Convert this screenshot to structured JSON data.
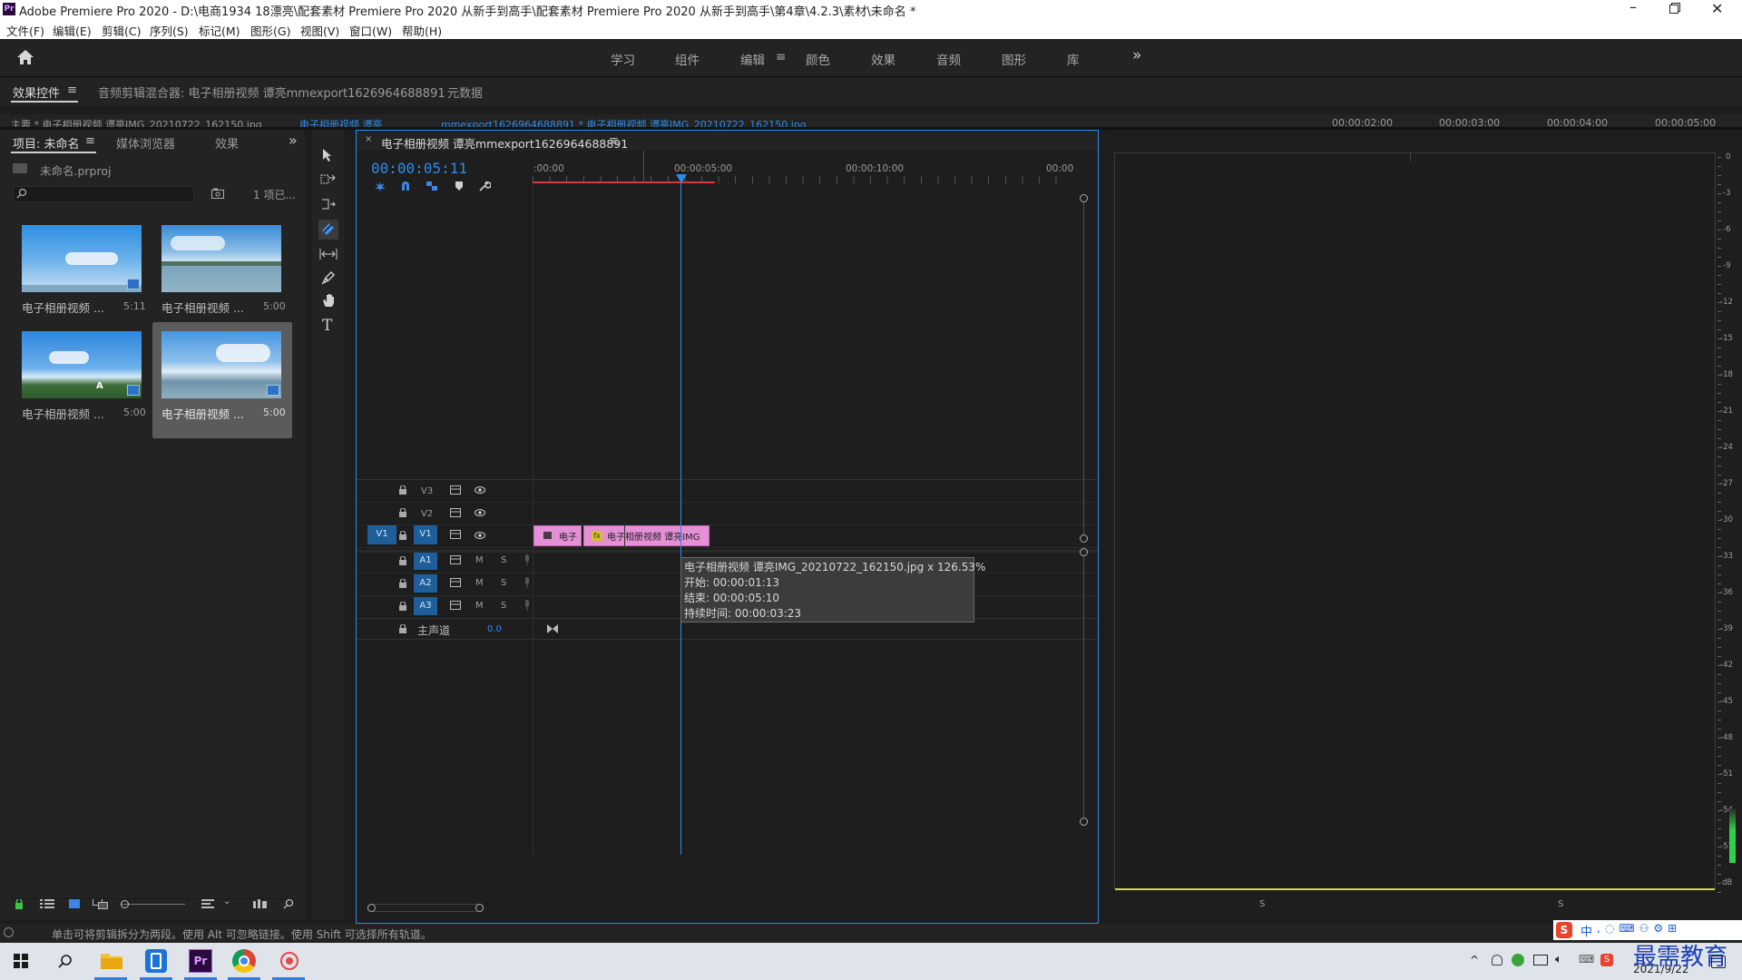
{
  "titlebar": {
    "title": "Adobe Premiere Pro 2020 - D:\\电商1934 18漂亮\\配套素材 Premiere Pro 2020 从新手到高手\\配套素材 Premiere Pro 2020 从新手到高手\\第4章\\4.2.3\\素材\\未命名 *",
    "app_icon": "Pr"
  },
  "menu": [
    "文件(F)",
    "编辑(E)",
    "剪辑(C)",
    "序列(S)",
    "标记(M)",
    "图形(G)",
    "视图(V)",
    "窗口(W)",
    "帮助(H)"
  ],
  "workspaces": {
    "tabs": [
      "学习",
      "组件",
      "编辑",
      "颜色",
      "效果",
      "音频",
      "图形",
      "库"
    ],
    "active": "编辑",
    "overflow": "»"
  },
  "upper_panel": {
    "tabs": [
      "效果控件",
      "音频剪辑混合器: 电子相册视频 谭亮mmexport1626964688891",
      "元数据"
    ],
    "active_menu": "≡",
    "ruler_times": [
      "00:00:02:00",
      "00:00:03:00",
      "00:00:04:00",
      "00:00:05:00"
    ],
    "clipped_text_1": "主要 * 电子相册视频 谭亮IMG_20210722_162150.jpg",
    "clipped_text_2": "电子相册视频 谭亮",
    "clipped_text_3": "mmexport1626964688891 * 电子相册视频 谭亮IMG_20210722_162150.jpg"
  },
  "project": {
    "tabs": [
      "项目: 未命名",
      "媒体浏览器",
      "效果"
    ],
    "file": "未命名.prproj",
    "count": "1 项已...",
    "search_placeholder": "",
    "items": [
      {
        "name": "电子相册视频 ...",
        "duration": "5:11"
      },
      {
        "name": "电子相册视频 ...",
        "duration": "5:00"
      },
      {
        "name": "电子相册视频 ...",
        "duration": "5:00"
      },
      {
        "name": "电子相册视频 ...",
        "duration": "5:00"
      }
    ]
  },
  "timeline": {
    "tab": "电子相册视频 谭亮mmexport1626964688891",
    "timecode": "00:00:05:11",
    "ruler": [
      ":00:00",
      "00:00:05:00",
      "00:00:10:00",
      "00:00"
    ],
    "video_tracks": [
      "V3",
      "V2",
      "V1"
    ],
    "audio_tracks": [
      "A1",
      "A2",
      "A3"
    ],
    "source_patch": "V1",
    "mute_label": "M",
    "solo_label": "S",
    "master": {
      "label": "主声道",
      "value": "0.0"
    },
    "clips": [
      {
        "label": "电子",
        "color": "#e590d6"
      },
      {
        "label": "电子相册视频 谭亮IMG",
        "color": "#e590d6"
      }
    ]
  },
  "tooltip": {
    "line1": "电子相册视频 谭亮IMG_20210722_162150.jpg x 126.53%",
    "line2": "开始: 00:00:01:13",
    "line3": "结束: 00:00:05:10",
    "line4": "持续时间: 00:00:03:23"
  },
  "audio_meter": {
    "scale": [
      "0",
      "-3",
      "-6",
      "-9",
      "-12",
      "-15",
      "-18",
      "-21",
      "-24",
      "-27",
      "-30",
      "-33",
      "-36",
      "-39",
      "-42",
      "-45",
      "-48",
      "-51",
      "-54",
      "-57",
      "dB"
    ],
    "solo_left": "S",
    "solo_right": "S"
  },
  "statusbar": {
    "text": "单击可将剪辑拆分为两段。使用 Alt 可忽略链接。使用 Shift 可选择所有轨道。"
  },
  "taskbar": {
    "date": "2021/9/22",
    "ime": "中",
    "watermark": "最需教育"
  },
  "colors": {
    "accent": "#2d8ceb",
    "panel_bg": "#232323",
    "clip_pink": "#e590d6",
    "playhead": "#2d8ceb",
    "work_area_red": "#d63a3a",
    "meter_green": "#2fd14a"
  }
}
